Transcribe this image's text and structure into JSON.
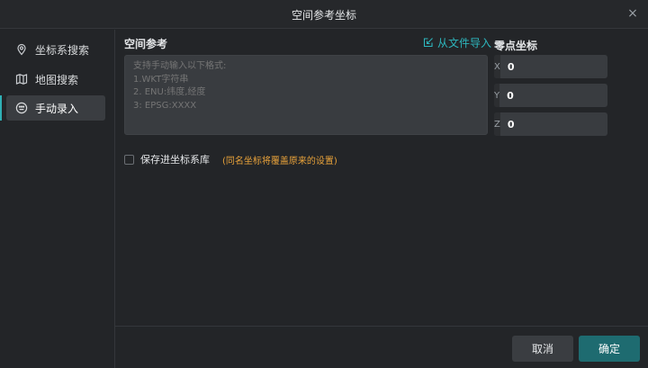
{
  "dialog": {
    "title": "空间参考坐标",
    "close_icon": "×"
  },
  "sidebar": {
    "items": [
      {
        "label": "坐标系搜索",
        "icon": "map-pin-icon",
        "active": false
      },
      {
        "label": "地图搜索",
        "icon": "map-icon",
        "active": false
      },
      {
        "label": "手动录入",
        "icon": "keyboard-icon",
        "active": true
      }
    ]
  },
  "reference": {
    "label": "空间参考",
    "import_label": "从文件导入",
    "placeholder": "支持手动输入以下格式:\n1.WKT字符串\n2. ENU:纬度,经度\n3: EPSG:XXXX"
  },
  "origin": {
    "label": "零点坐标",
    "fields": [
      {
        "axis": "X",
        "value": "0"
      },
      {
        "axis": "Y",
        "value": "0"
      },
      {
        "axis": "Z",
        "value": "0"
      }
    ]
  },
  "save": {
    "label": "保存进坐标系库",
    "checked": false,
    "warning": "(同名坐标将覆盖原来的设置)"
  },
  "footer": {
    "cancel_label": "取消",
    "ok_label": "确定"
  },
  "colors": {
    "accent": "#2fb0b5",
    "primary_button": "#1e6b70",
    "warning": "#e8a23a"
  }
}
